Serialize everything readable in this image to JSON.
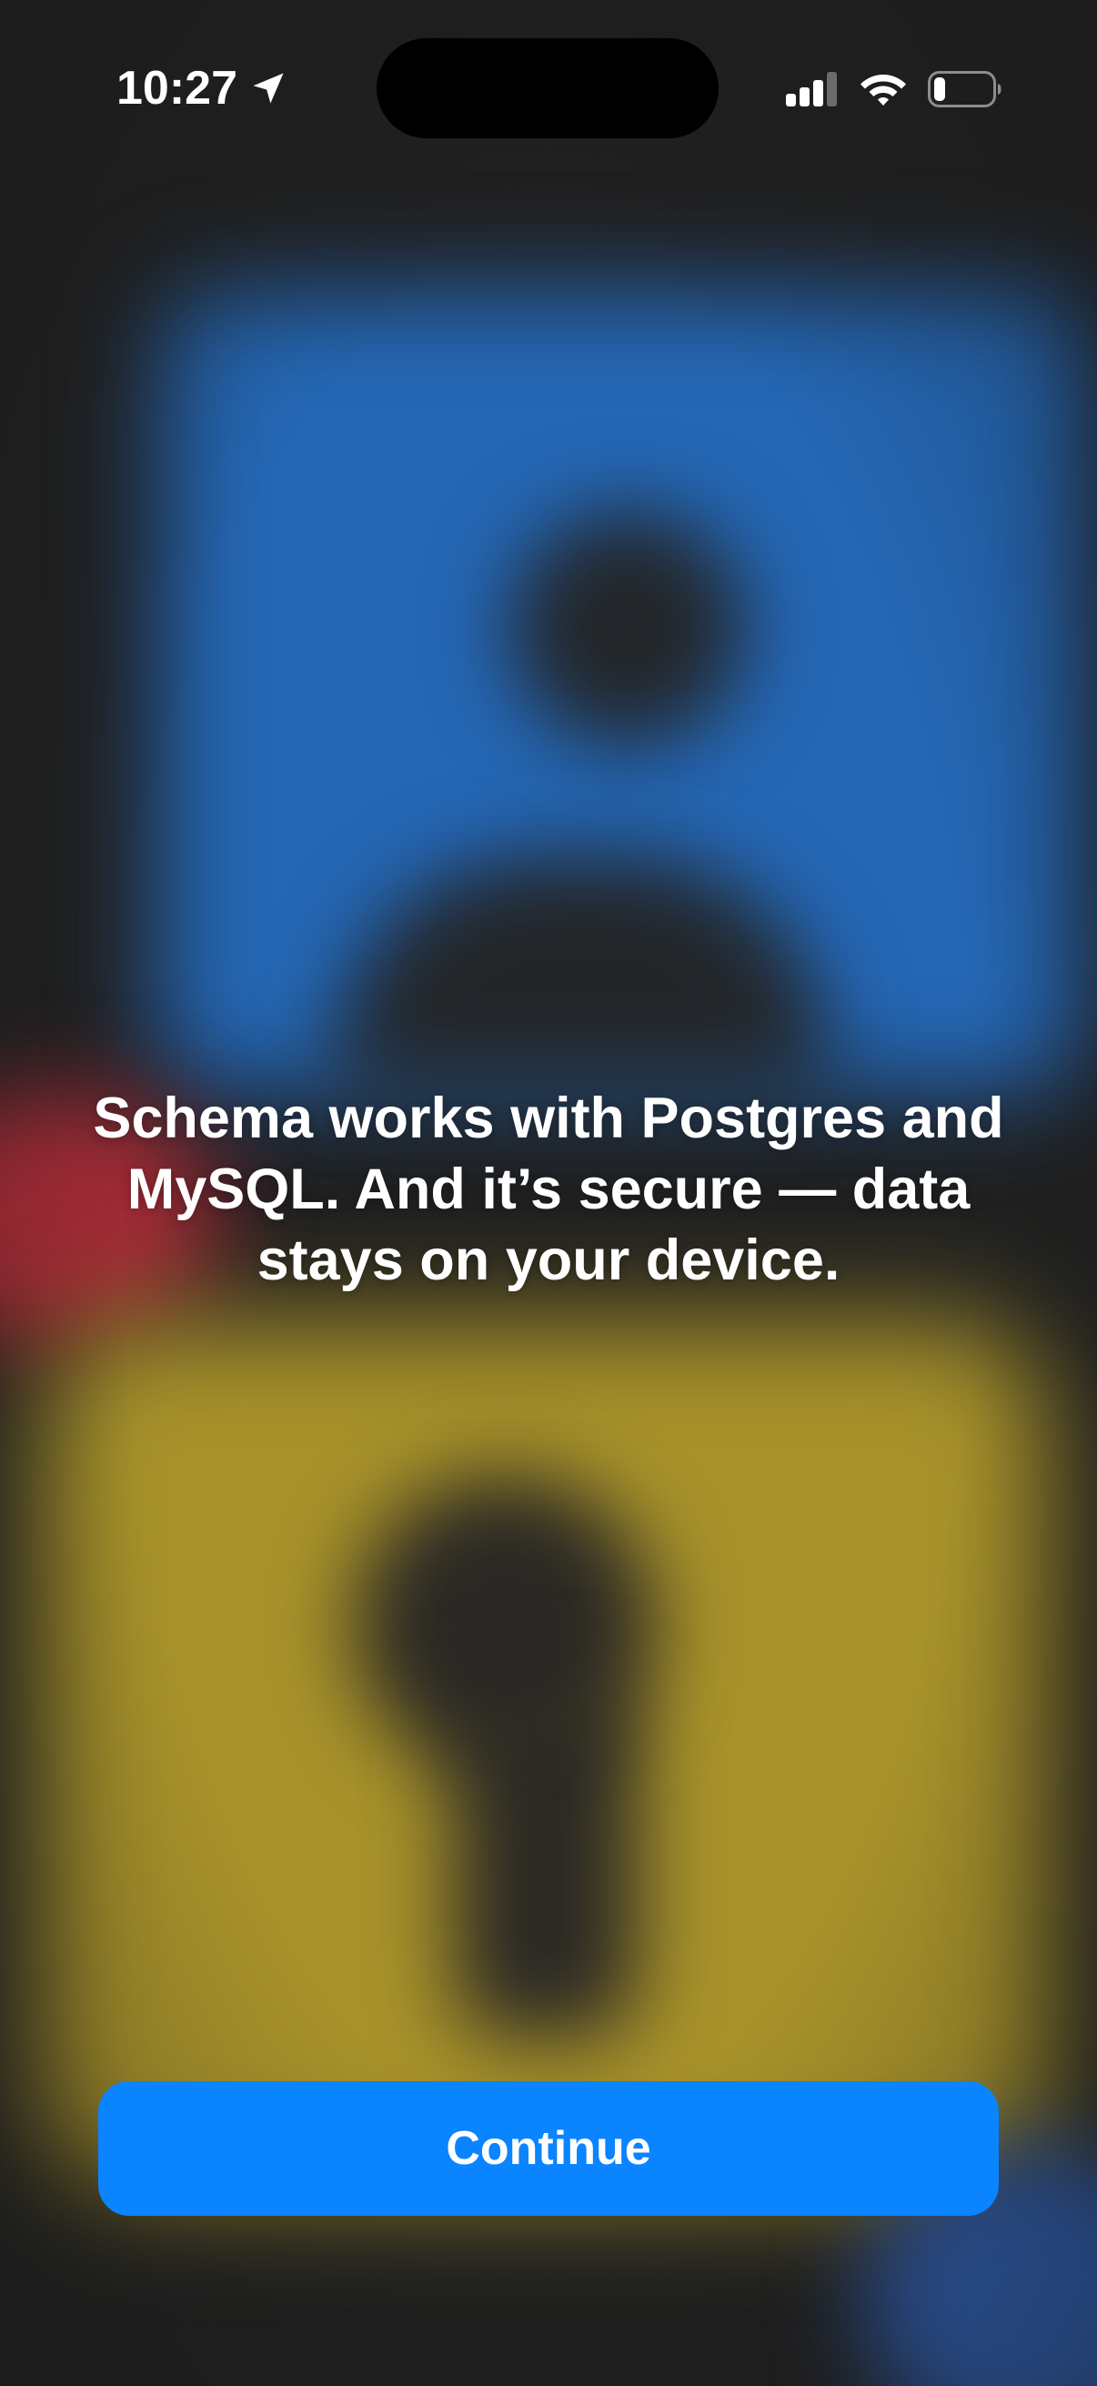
{
  "status_bar": {
    "time": "10:27",
    "location_icon": "location-arrow-icon",
    "signal_icon": "cellular-signal-icon",
    "wifi_icon": "wifi-icon",
    "battery_icon": "battery-icon",
    "battery_level": 0.2
  },
  "onboarding": {
    "headline": "Schema works with Postgres and MySQL. And it’s secure —  data stays on your device.",
    "continue_label": "Continue"
  },
  "colors": {
    "accent": "#0a84ff",
    "background": "#202020",
    "art_blue": "#2467b5",
    "art_yellow": "#a8922a",
    "art_red": "#a12a35"
  }
}
